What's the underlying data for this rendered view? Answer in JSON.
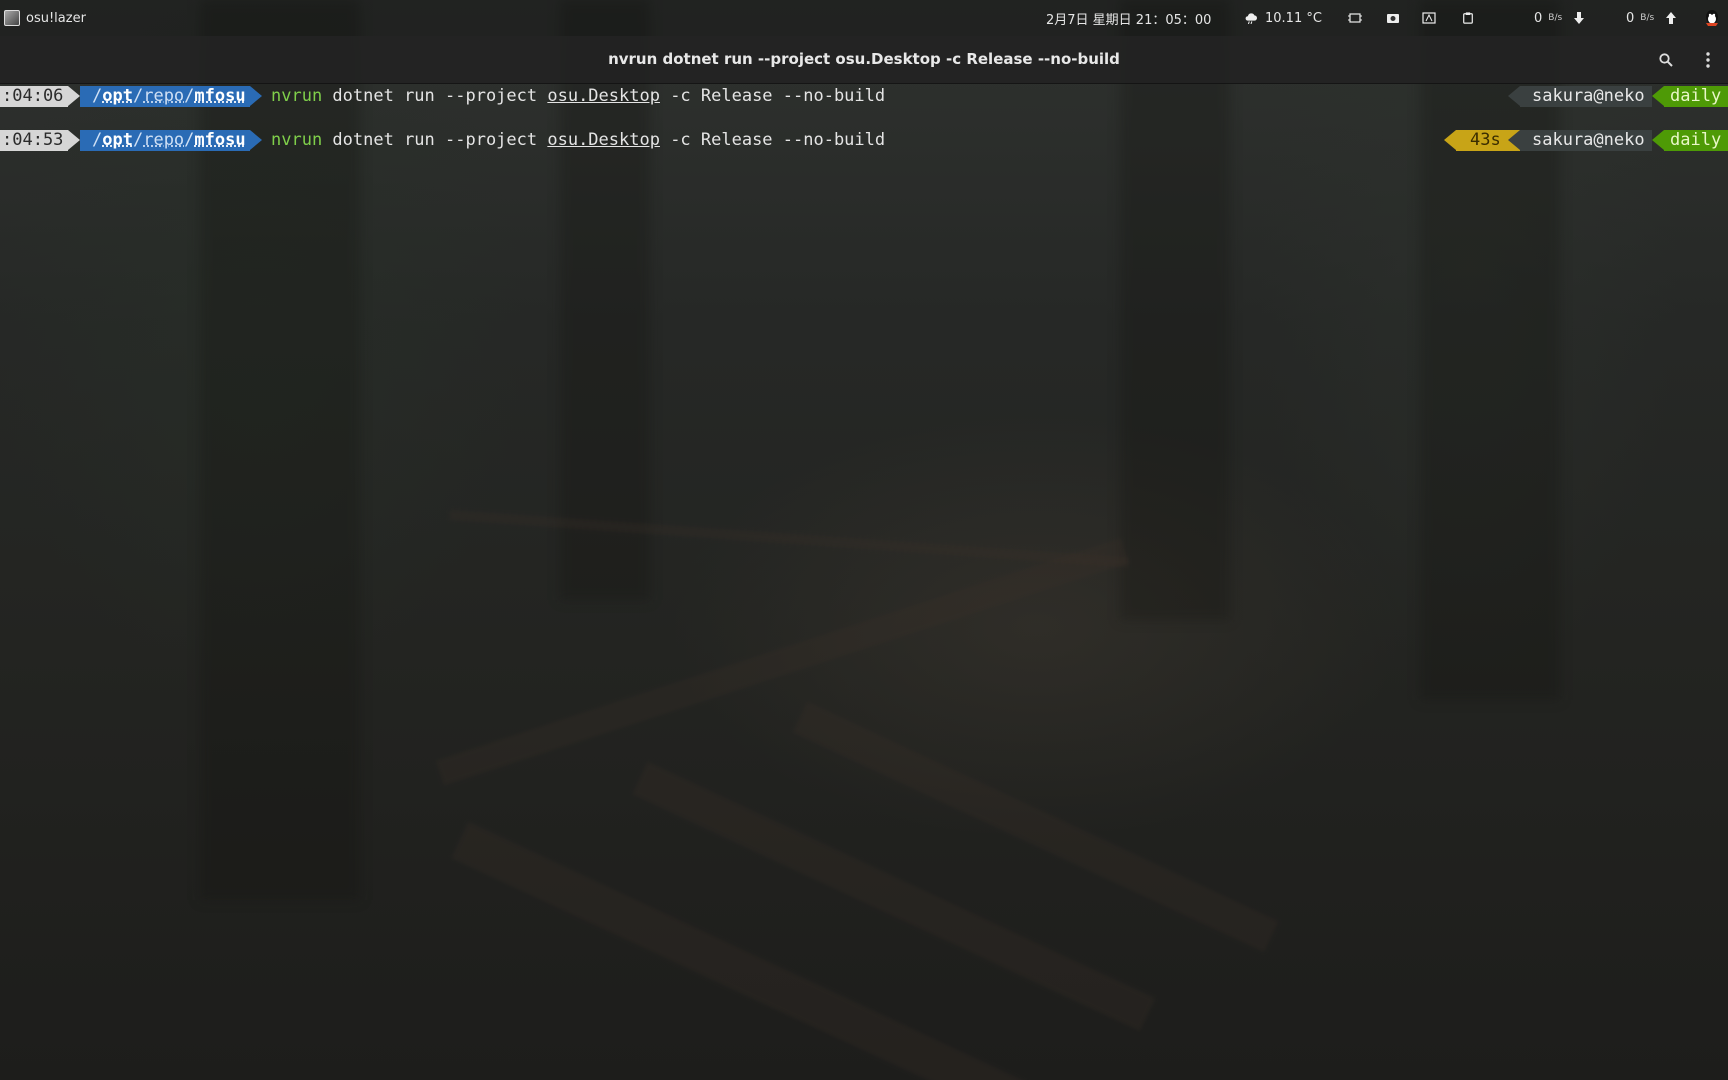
{
  "panel": {
    "app_name": "osu!lazer",
    "datetime": "2月7日 星期日 21：05：00",
    "weather_temp": "10.11 °C",
    "net_down": "0",
    "net_down_unit": "B/s",
    "net_up": "0",
    "net_up_unit": "B/s"
  },
  "terminal": {
    "title": "nvrun dotnet run --project osu.Desktop -c Release --no-build",
    "lines": [
      {
        "time": ":04:06",
        "path_parts": [
          "/",
          "opt",
          "/",
          "repo",
          "/",
          "mfosu"
        ],
        "cmd_program": "nvrun",
        "cmd_args_a": " dotnet run --project ",
        "cmd_link": "osu.Desktop",
        "cmd_args_b": " -c Release --no-build",
        "duration": "",
        "user_host": "sakura@neko",
        "branch": "daily"
      },
      {
        "time": ":04:53",
        "path_parts": [
          "/",
          "opt",
          "/",
          "repo",
          "/",
          "mfosu"
        ],
        "cmd_program": "nvrun",
        "cmd_args_a": " dotnet run --project ",
        "cmd_link": "osu.Desktop",
        "cmd_args_b": " -c Release --no-build",
        "duration": "43s",
        "user_host": "sakura@neko",
        "branch": "daily"
      }
    ]
  },
  "colors": {
    "path_bg": "#2a6bb5",
    "time_bg": "#d6d6d6",
    "duration_bg": "#c8a417",
    "branch_bg": "#4e9a06",
    "userhost_bg": "#3a4040",
    "cmd_program": "#7fcf4a"
  },
  "icons": [
    "app-icon",
    "weather-icon",
    "screenshot-icon",
    "camera-icon",
    "display-icon",
    "clipboard-icon",
    "download-arrow-icon",
    "upload-arrow-icon",
    "qq-penguin-icon",
    "search-icon",
    "kebab-menu-icon"
  ]
}
